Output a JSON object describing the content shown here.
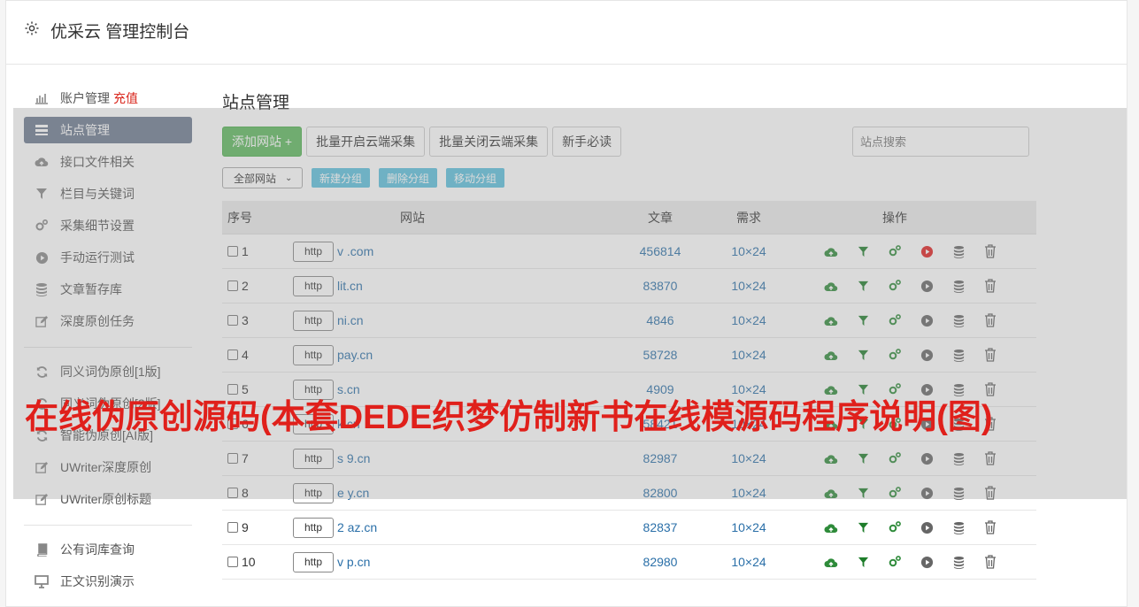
{
  "header": {
    "title": "优采云 管理控制台"
  },
  "sidebar": {
    "items": [
      {
        "label": "账户管理",
        "extra": "充值",
        "icon": "bar-chart-icon"
      },
      {
        "label": "站点管理",
        "icon": "list-icon",
        "active": true
      },
      {
        "label": "接口文件相关",
        "icon": "cloud-upload-icon"
      },
      {
        "label": "栏目与关键词",
        "icon": "filter-icon"
      },
      {
        "label": "采集细节设置",
        "icon": "gears-icon"
      },
      {
        "label": "手动运行测试",
        "icon": "play-circle-icon"
      },
      {
        "label": "文章暂存库",
        "icon": "database-icon"
      },
      {
        "label": "深度原创任务",
        "icon": "edit-icon"
      }
    ],
    "items2": [
      {
        "label": "同义词伪原创[1版]",
        "icon": "refresh-icon"
      },
      {
        "label": "同义词伪原创[2版]",
        "icon": "refresh-icon"
      },
      {
        "label": "智能伪原创[AI版]",
        "icon": "refresh-icon"
      },
      {
        "label": "UWriter深度原创",
        "icon": "edit-icon"
      },
      {
        "label": "UWriter原创标题",
        "icon": "edit-icon"
      }
    ],
    "items3": [
      {
        "label": "公有词库查询",
        "icon": "book-icon"
      },
      {
        "label": "正文识别演示",
        "icon": "monitor-icon"
      }
    ]
  },
  "main": {
    "title": "站点管理",
    "toolbar": {
      "add": "添加网站 +",
      "batch_on": "批量开启云端采集",
      "batch_off": "批量关闭云端采集",
      "guide": "新手必读",
      "search_placeholder": "站点搜索"
    },
    "group": {
      "select": "全部网站",
      "new": "新建分组",
      "delete": "删除分组",
      "move": "移动分组"
    },
    "table": {
      "headers": [
        "序号",
        "网站",
        "文章",
        "需求",
        "操作"
      ],
      "rows": [
        {
          "no": "1",
          "proto": "http",
          "site": "v .com",
          "articles": "456814",
          "req": "10×24",
          "running": true
        },
        {
          "no": "2",
          "proto": "http",
          "site": "lit.cn",
          "articles": "83870",
          "req": "10×24",
          "running": false
        },
        {
          "no": "3",
          "proto": "http",
          "site": "ni.cn",
          "articles": "4846",
          "req": "10×24",
          "running": false
        },
        {
          "no": "4",
          "proto": "http",
          "site": "pay.cn",
          "articles": "58728",
          "req": "10×24",
          "running": false
        },
        {
          "no": "5",
          "proto": "http",
          "site": "s.cn",
          "articles": "4909",
          "req": "10×24",
          "running": false
        },
        {
          "no": "6",
          "proto": "http",
          "site": "k.cn",
          "articles": "58421",
          "req": "10×24",
          "running": false
        },
        {
          "no": "7",
          "proto": "http",
          "site": "s 9.cn",
          "articles": "82987",
          "req": "10×24",
          "running": false
        },
        {
          "no": "8",
          "proto": "http",
          "site": "e y.cn",
          "articles": "82800",
          "req": "10×24",
          "running": false
        },
        {
          "no": "9",
          "proto": "http",
          "site": "2 az.cn",
          "articles": "82837",
          "req": "10×24",
          "running": false
        },
        {
          "no": "10",
          "proto": "http",
          "site": "v p.cn",
          "articles": "82980",
          "req": "10×24",
          "running": false
        }
      ]
    }
  },
  "watermark": "在线伪原创源码(本套DEDE织梦仿制新书在线模源码程序说明(图)",
  "colors": {
    "accent": "#6c7a8f",
    "green": "#5cb85c",
    "info": "#5bc0de",
    "link": "#2a6fa8",
    "watermark": "#e0201b"
  }
}
